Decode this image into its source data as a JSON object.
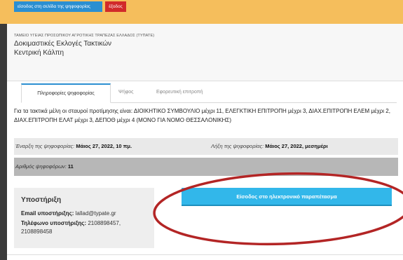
{
  "topbar": {
    "ballot_site_button": "είσοδος στη σελίδα της ψηφοφορίας",
    "exit_button": "έξοδος",
    "background": "#f5be5c"
  },
  "header": {
    "organization": "ΤΑΜΕΙΟ ΥΓΕΙΑΣ ΠΡΟΣΩΠΙΚΟΥ ΑΓΡΟΤΙΚΗΣ ΤΡΑΠΕΖΑΣ ΕΛΛΑΔΟΣ (ΤΥΠΑΤΕ)",
    "election_title": "Δοκιμαστικές Εκλογές Τακτικών",
    "ballot_box": "Κεντρική Κάλπη"
  },
  "tabs": [
    {
      "label": "Πληροφορίες ψηφοφορίας",
      "active": true
    },
    {
      "label": "Ψήφος",
      "active": false
    },
    {
      "label": "Εφορευτική επιτροπή",
      "active": false
    }
  ],
  "info": {
    "text": "Για τα τακτικά μέλη οι σταυροί προτίμησης είναι: ΔΙΟΙΚΗΤΙΚΟ ΣΥΜΒΟΥΛΙΟ μέχρι 11, ΕΛΕΓΚΤΙΚΗ ΕΠΙΤΡΟΠΗ μέχρι 3, ΔΙΑΧ.ΕΠΙΤΡΟΠΗ ΕΛΕΜ μέχρι 2, ΔΙΑΧ.ΕΠΙΤΡΟΠΗ ΕΛΑΤ μέχρι 3, ΔΕΠΟΘ μέχρι 4 (ΜΟΝΟ ΓΙΑ ΝΟΜΟ ΘΕΣΣΑΛΟΝΙΚΗΣ)"
  },
  "schedule": {
    "start_label": "Έναρξη της ψηφοφορίας:",
    "start_value": "Μάιος 27, 2022, 10 πμ.",
    "end_label": "Λήξη της ψηφοφορίας:",
    "end_value": "Μάιος 27, 2022, μεσημέρι"
  },
  "voters": {
    "label": "Αριθμός ψηφοφόρων:",
    "value": "11"
  },
  "support": {
    "title": "Υποστήριξη",
    "email_label": "Email υποστήριξης:",
    "email_value": "lallad@typate.gr",
    "phone_label": "Τηλέφωνο υποστήριξης:",
    "phone_value": "2108898457, 2108898458"
  },
  "enter_booth_button": "Είσοδος στο ηλεκτρονικό παραπέτασμα",
  "colors": {
    "accent": "#32b7ea",
    "exit": "#d12a2a",
    "annotation": "#b32525"
  }
}
